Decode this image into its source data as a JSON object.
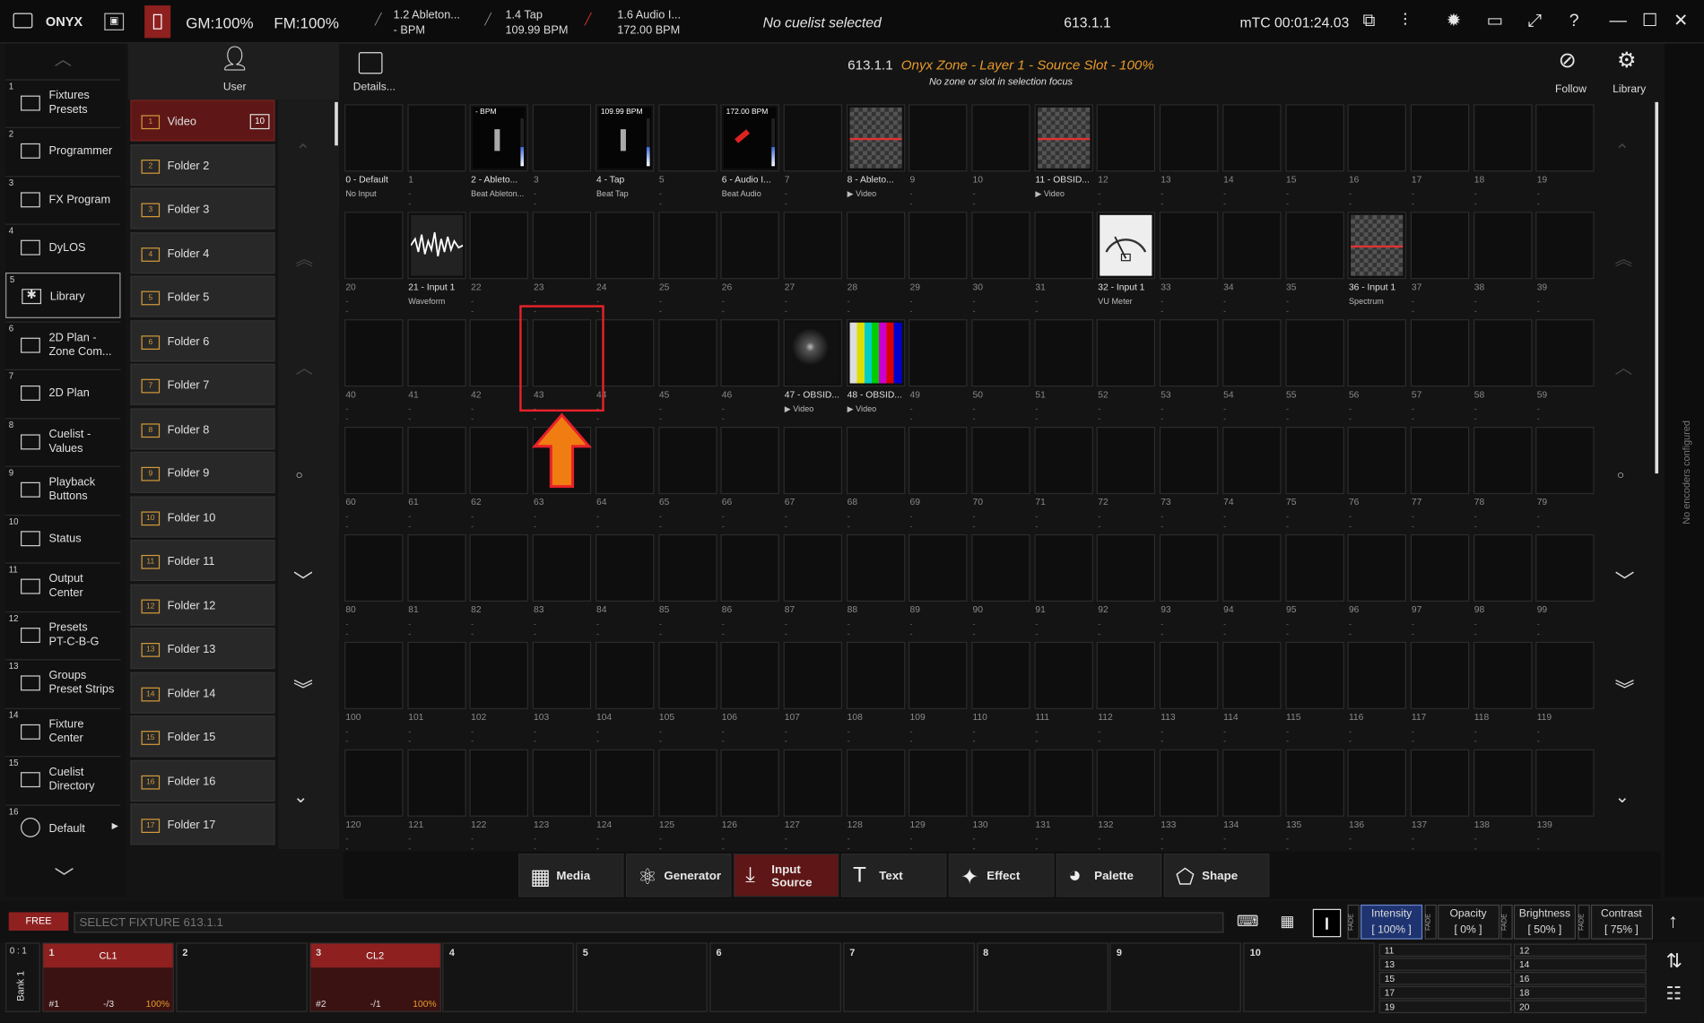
{
  "topbar": {
    "app_name": "ONYX",
    "gm": "GM:100%",
    "fm": "FM:100%",
    "sources": [
      {
        "line1": "1.2 Ableton...",
        "line2": "- BPM"
      },
      {
        "line1": "1.4 Tap",
        "line2": "109.99 BPM"
      },
      {
        "line1": "1.6 Audio I...",
        "line2": "172.00 BPM"
      }
    ],
    "cuelist": "No cuelist selected",
    "position": "613.1.1",
    "timecode": "mTC 00:01:24.03"
  },
  "leftnav": {
    "items": [
      {
        "num": "1",
        "label": "Fixtures\nPresets"
      },
      {
        "num": "2",
        "label": "Programmer"
      },
      {
        "num": "3",
        "label": "FX Program"
      },
      {
        "num": "4",
        "label": "DyLOS"
      },
      {
        "num": "5",
        "label": "Library"
      },
      {
        "num": "6",
        "label": "2D Plan -\nZone Com..."
      },
      {
        "num": "7",
        "label": "2D Plan"
      },
      {
        "num": "8",
        "label": "Cuelist -\nValues"
      },
      {
        "num": "9",
        "label": "Playback\nButtons"
      },
      {
        "num": "10",
        "label": "Status"
      },
      {
        "num": "11",
        "label": "Output\nCenter"
      },
      {
        "num": "12",
        "label": "Presets\nPT-C-B-G"
      },
      {
        "num": "13",
        "label": "Groups\nPreset Strips"
      },
      {
        "num": "14",
        "label": "Fixture\nCenter"
      },
      {
        "num": "15",
        "label": "Cuelist\nDirectory"
      },
      {
        "num": "16",
        "label": "Default"
      }
    ]
  },
  "folders": {
    "user_label": "User",
    "details_label": "Details...",
    "items": [
      {
        "num": "1",
        "label": "Video",
        "count": "10"
      },
      {
        "num": "2",
        "label": "Folder 2"
      },
      {
        "num": "3",
        "label": "Folder 3"
      },
      {
        "num": "4",
        "label": "Folder 4"
      },
      {
        "num": "5",
        "label": "Folder 5"
      },
      {
        "num": "6",
        "label": "Folder 6"
      },
      {
        "num": "7",
        "label": "Folder 7"
      },
      {
        "num": "8",
        "label": "Folder 8"
      },
      {
        "num": "9",
        "label": "Folder 9"
      },
      {
        "num": "10",
        "label": "Folder 10"
      },
      {
        "num": "11",
        "label": "Folder 11"
      },
      {
        "num": "12",
        "label": "Folder 12"
      },
      {
        "num": "13",
        "label": "Folder 13"
      },
      {
        "num": "14",
        "label": "Folder 14"
      },
      {
        "num": "15",
        "label": "Folder 15"
      },
      {
        "num": "16",
        "label": "Folder 16"
      },
      {
        "num": "17",
        "label": "Folder 17"
      }
    ]
  },
  "header": {
    "id": "613.1.1",
    "zone_title": "Onyx Zone - Layer 1 - Source Slot  -  100%",
    "subtitle": "No zone or slot in selection focus",
    "follow_label": "Follow",
    "library_label": "Library"
  },
  "slots": [
    {
      "n": 0,
      "name": "0 - Default",
      "sub": "No Input",
      "thumb": "dark"
    },
    {
      "n": 2,
      "name": "2 - Ableto...",
      "sub": "Beat  Ableton...",
      "thumb": "beat",
      "top": "- BPM"
    },
    {
      "n": 4,
      "name": "4 - Tap",
      "sub": "Beat Tap",
      "thumb": "beat",
      "top": "109.99 BPM"
    },
    {
      "n": 6,
      "name": "6 - Audio I...",
      "sub": "Beat Audio",
      "thumb": "beatred",
      "top": "172.00 BPM"
    },
    {
      "n": 8,
      "name": "8 - Ableto...",
      "sub": "▶ Video",
      "thumb": "checker"
    },
    {
      "n": 11,
      "name": "11 - OBSID...",
      "sub": "▶ Video",
      "thumb": "checker"
    },
    {
      "n": 21,
      "name": "21 - Input 1",
      "sub": "Waveform",
      "thumb": "wave"
    },
    {
      "n": 32,
      "name": "32 - Input 1",
      "sub": "VU Meter",
      "thumb": "vu"
    },
    {
      "n": 36,
      "name": "36 - Input 1",
      "sub": "Spectrum",
      "thumb": "checker"
    },
    {
      "n": 47,
      "name": "47 - OBSID...",
      "sub": "▶ Video",
      "thumb": "photo"
    },
    {
      "n": 48,
      "name": "48 - OBSID...",
      "sub": "▶ Video",
      "thumb": "bars"
    }
  ],
  "empty_marker": "---",
  "types": [
    {
      "label": "Media",
      "icon": "media-icon"
    },
    {
      "label": "Generator",
      "icon": "generator-icon"
    },
    {
      "label": "Input Source",
      "icon": "input-source-icon",
      "selected": true
    },
    {
      "label": "Text",
      "icon": "text-icon"
    },
    {
      "label": "Effect",
      "icon": "effect-icon"
    },
    {
      "label": "Palette",
      "icon": "palette-icon"
    },
    {
      "label": "Shape",
      "icon": "shape-icon"
    }
  ],
  "cmdline": {
    "mode": "FREE",
    "placeholder": "SELECT FIXTURE 613.1.1",
    "attrs": [
      {
        "label": "Intensity",
        "value": "[ 100% ]"
      },
      {
        "label": "Opacity",
        "value": "[ 0% ]"
      },
      {
        "label": "Brightness",
        "value": "[ 50% ]"
      },
      {
        "label": "Contrast",
        "value": "[ 75% ]"
      }
    ],
    "fade": "FADE"
  },
  "playbacks": {
    "bank_page": "0 : 1",
    "bank_label": "Bank 1",
    "buttons": [
      {
        "n": "1",
        "cue": "CL1",
        "num": "#1",
        "step": "-/3",
        "pct": "100%"
      },
      {
        "n": "2"
      },
      {
        "n": "3",
        "cue": "CL2",
        "num": "#2",
        "step": "-/1",
        "pct": "100%"
      },
      {
        "n": "4"
      },
      {
        "n": "5"
      },
      {
        "n": "6"
      },
      {
        "n": "7"
      },
      {
        "n": "8"
      },
      {
        "n": "9"
      },
      {
        "n": "10"
      }
    ],
    "mini": [
      "11",
      "12",
      "13",
      "14",
      "15",
      "16",
      "17",
      "18",
      "19",
      "20"
    ]
  },
  "side_note": "No encoders configured",
  "colors": {
    "accent": "#8e2020",
    "orange": "#e89a2a",
    "highlight": "#e8212a"
  }
}
